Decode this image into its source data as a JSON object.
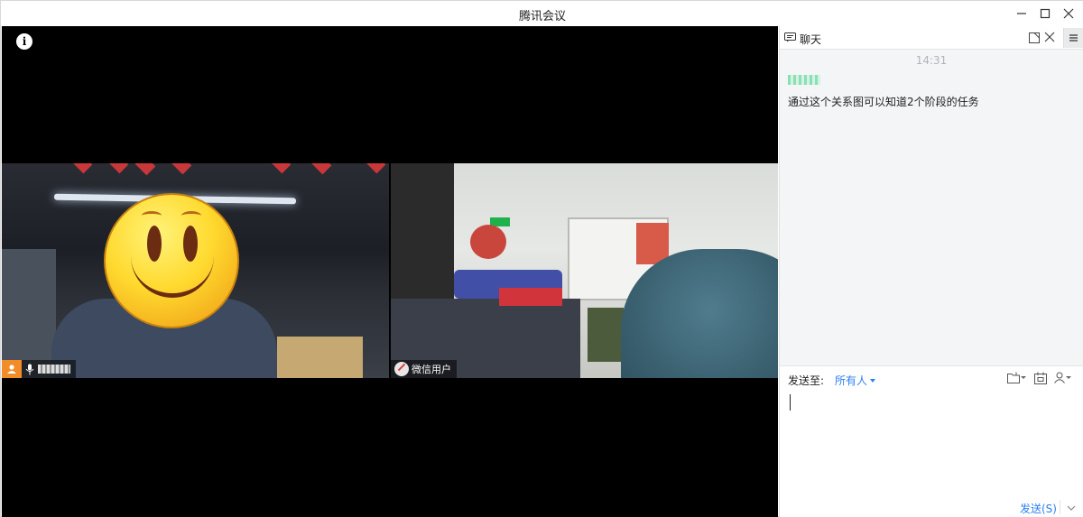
{
  "window": {
    "title": "腾讯会议"
  },
  "stage": {
    "tiles": [
      {
        "name": "",
        "host": true,
        "mic": true
      },
      {
        "name": "微信用户",
        "host": false,
        "mic": false
      }
    ]
  },
  "chat": {
    "title": "聊天",
    "messages": [
      {
        "time": "14:31",
        "text": "通过这个关系图可以知道2个阶段的任务"
      }
    ],
    "compose": {
      "send_to_label": "发送至:",
      "send_to_value": "所有人",
      "send_button": "发送(S)"
    }
  },
  "colors": {
    "accent": "#2a7ff2",
    "host_badge": "#f28c28",
    "chat_bg": "#f4f5f7"
  },
  "icons": [
    "info-icon",
    "minimize-icon",
    "maximize-icon",
    "close-icon",
    "chat-icon",
    "popout-icon",
    "panel-close-icon",
    "menu-icon",
    "host-icon",
    "microphone-icon",
    "wechat-icon",
    "file-icon",
    "calendar-icon",
    "contact-icon",
    "chevron-down-icon"
  ]
}
